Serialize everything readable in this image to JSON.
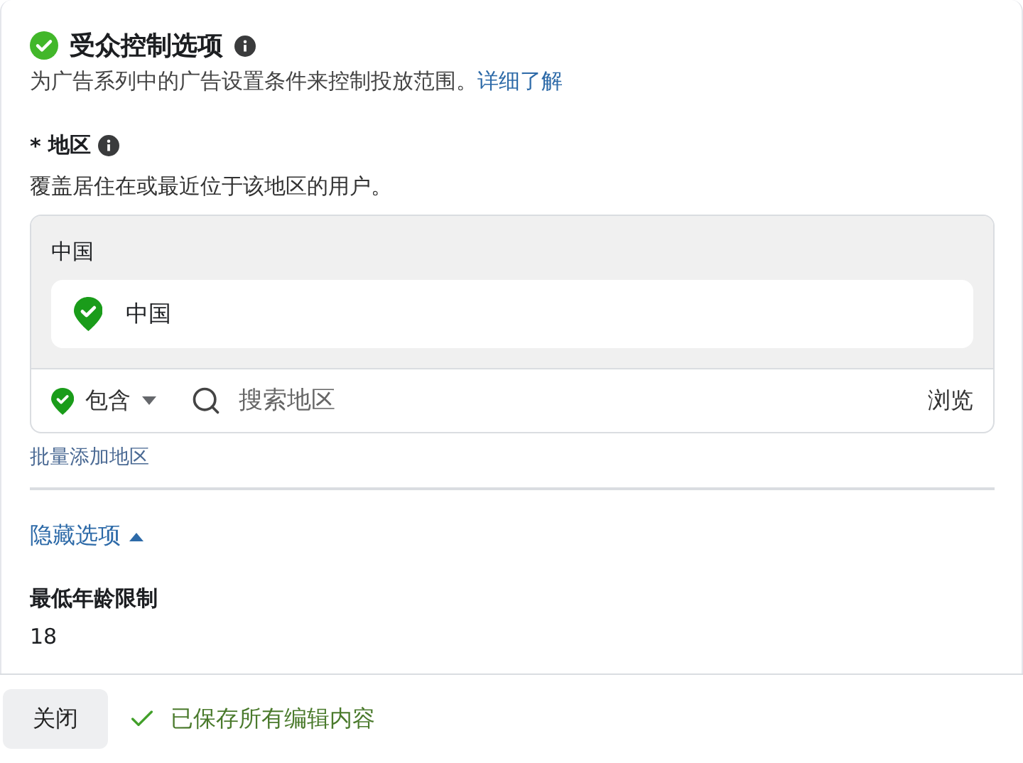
{
  "section": {
    "title": "受众控制选项",
    "complete": true,
    "description": "为广告系列中的广告设置条件来控制投放范围。",
    "learn_more": "详细了解"
  },
  "location": {
    "required_mark": "*",
    "label": "地区",
    "help": "覆盖居住在或最近位于该地区的用户。",
    "group_title": "中国",
    "items": [
      {
        "name": "中国"
      }
    ],
    "mode": "包含",
    "search_placeholder": "搜索地区",
    "browse": "浏览",
    "bulk_add": "批量添加地区"
  },
  "options_toggle": {
    "label": "隐藏选项",
    "expanded": true
  },
  "min_age": {
    "label": "最低年龄限制",
    "value": "18"
  },
  "footer": {
    "close": "关闭",
    "status": "已保存所有编辑内容"
  }
}
